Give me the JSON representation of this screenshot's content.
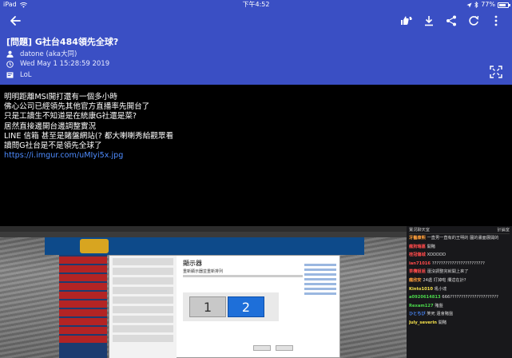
{
  "status_bar": {
    "device": "iPad",
    "time": "下午4:52",
    "battery_percent": "77%",
    "battery_level": 0.77
  },
  "toolbar": {
    "back_icon": "arrow-back-icon",
    "actions": [
      {
        "name": "thumbs-icon"
      },
      {
        "name": "download-icon"
      },
      {
        "name": "share-icon"
      },
      {
        "name": "refresh-icon"
      },
      {
        "name": "more-vert-icon"
      }
    ]
  },
  "post": {
    "title": "[問題] G社台484領先全球?",
    "author": "datone (aka大同)",
    "date": "Wed May  1 15:28:59 2019",
    "board": "LoL"
  },
  "content": {
    "lines": [
      "明明距離MSI開打還有一個多小時",
      "佛心公司已經領先其他官方直播率先開台了",
      "只是工讀生不知道是在統康G社還是菜?",
      "居然直接邊開台邊調整實況",
      "LINE 信箱 甚至是賭盤網站(? 都大喇喇秀給觀眾看",
      "讀問G社台是不是領先全球了"
    ],
    "link": "https://i.imgur.com/uMIyi5x.jpg"
  },
  "embed": {
    "window_title": "顯示器",
    "window_subtitle": "重新顯示器並重新排列",
    "monitor_1": "1",
    "monitor_2": "2",
    "chat_header_left": "實況聊天室",
    "chat_header_right": "計論室",
    "chat": [
      {
        "user": "牙醫康熙",
        "text": "一直男一直有的王明的 圖的畫面展開的"
      },
      {
        "user": "瘋狗瑞嘉",
        "text": "開賭"
      },
      {
        "user": "桂冠傷城",
        "text": "XDDDDD"
      },
      {
        "user": "ian71016",
        "text": "????????????????????????"
      },
      {
        "user": "茶欖姐姐",
        "text": "還沒調整完就開上來了"
      },
      {
        "user": "瘋欣安",
        "text": "24處 打掉啦 爛這在計?"
      },
      {
        "user": "Kinto1010",
        "text": "吼小達"
      },
      {
        "user": "a0920614813",
        "text": "666??????????????????????"
      },
      {
        "user": "Rexam127",
        "text": "賭盤"
      },
      {
        "user": "ひとちび",
        "text": "笑死 還會賭盤"
      },
      {
        "user": "July_severin",
        "text": "開賭"
      }
    ],
    "colors": {
      "user_red": "#ff4b4b",
      "user_green": "#4bd84b",
      "user_blue": "#4b8bff",
      "user_orange": "#ff9f3b",
      "user_yellow": "#f5e14b"
    }
  },
  "colors": {
    "header_bg": "#3a4fc4",
    "link": "#4e8cff",
    "body_bg": "#000000"
  }
}
